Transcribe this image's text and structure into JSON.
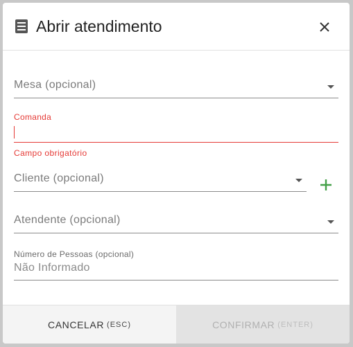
{
  "dialog": {
    "title": "Abrir atendimento",
    "icons": {
      "title_icon": "document-list-icon",
      "close_icon": "close-icon"
    }
  },
  "fields": {
    "mesa": {
      "placeholder": "Mesa (opcional)"
    },
    "comanda": {
      "label": "Comanda",
      "value": "",
      "error": "Campo obrigatório"
    },
    "cliente": {
      "placeholder": "Cliente (opcional)",
      "add_icon": "plus-icon"
    },
    "atendente": {
      "placeholder": "Atendente (opcional)"
    },
    "pessoas": {
      "label": "Número de Pessoas (opcional)",
      "placeholder": "Não Informado"
    }
  },
  "footer": {
    "cancel_label": "CANCELAR",
    "cancel_hint": "(ESC)",
    "confirm_label": "CONFIRMAR",
    "confirm_hint": "(ENTER)"
  },
  "colors": {
    "error": "#e53935",
    "add": "#43a047",
    "confirm_disabled_bg": "#e3e3e3",
    "cancel_bg": "#f4f4f4"
  }
}
